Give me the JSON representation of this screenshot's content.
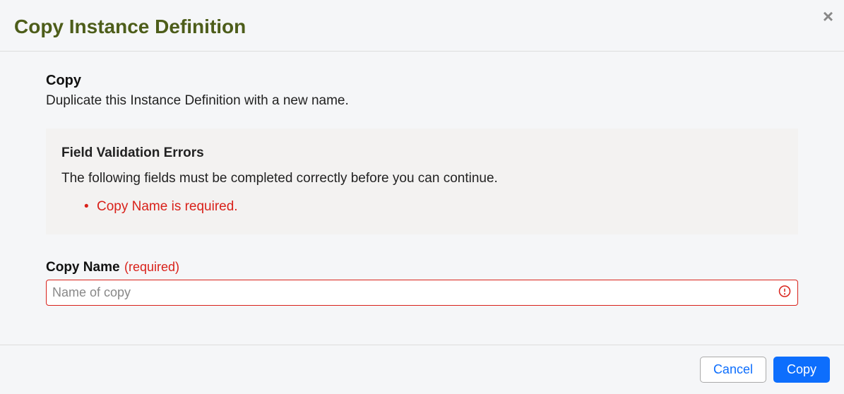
{
  "dialog": {
    "title": "Copy Instance Definition",
    "close_icon": "×"
  },
  "section": {
    "title": "Copy",
    "description": "Duplicate this Instance Definition with a new name."
  },
  "validation": {
    "title": "Field Validation Errors",
    "message": "The following fields must be completed correctly before you can continue.",
    "errors": [
      "Copy Name is required."
    ]
  },
  "field": {
    "label": "Copy Name",
    "required_marker": "(required)",
    "placeholder": "Name of copy",
    "value": ""
  },
  "footer": {
    "cancel_label": "Cancel",
    "confirm_label": "Copy"
  }
}
